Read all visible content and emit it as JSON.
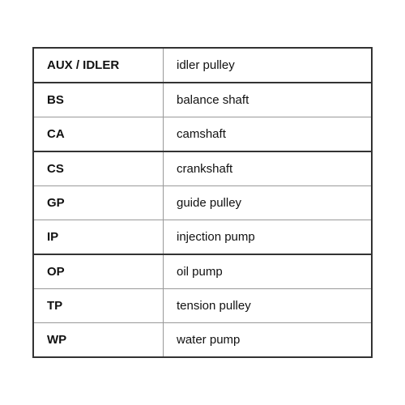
{
  "table": {
    "rows": [
      {
        "abbr": "AUX / IDLER",
        "desc": "idler pulley",
        "thick": true
      },
      {
        "abbr": "BS",
        "desc": "balance shaft",
        "thick": false
      },
      {
        "abbr": "CA",
        "desc": "camshaft",
        "thick": true
      },
      {
        "abbr": "CS",
        "desc": "crankshaft",
        "thick": false
      },
      {
        "abbr": "GP",
        "desc": "guide pulley",
        "thick": false
      },
      {
        "abbr": "IP",
        "desc": "injection pump",
        "thick": true
      },
      {
        "abbr": "OP",
        "desc": "oil pump",
        "thick": false
      },
      {
        "abbr": "TP",
        "desc": "tension pulley",
        "thick": false
      },
      {
        "abbr": "WP",
        "desc": "water pump",
        "thick": false
      }
    ]
  }
}
